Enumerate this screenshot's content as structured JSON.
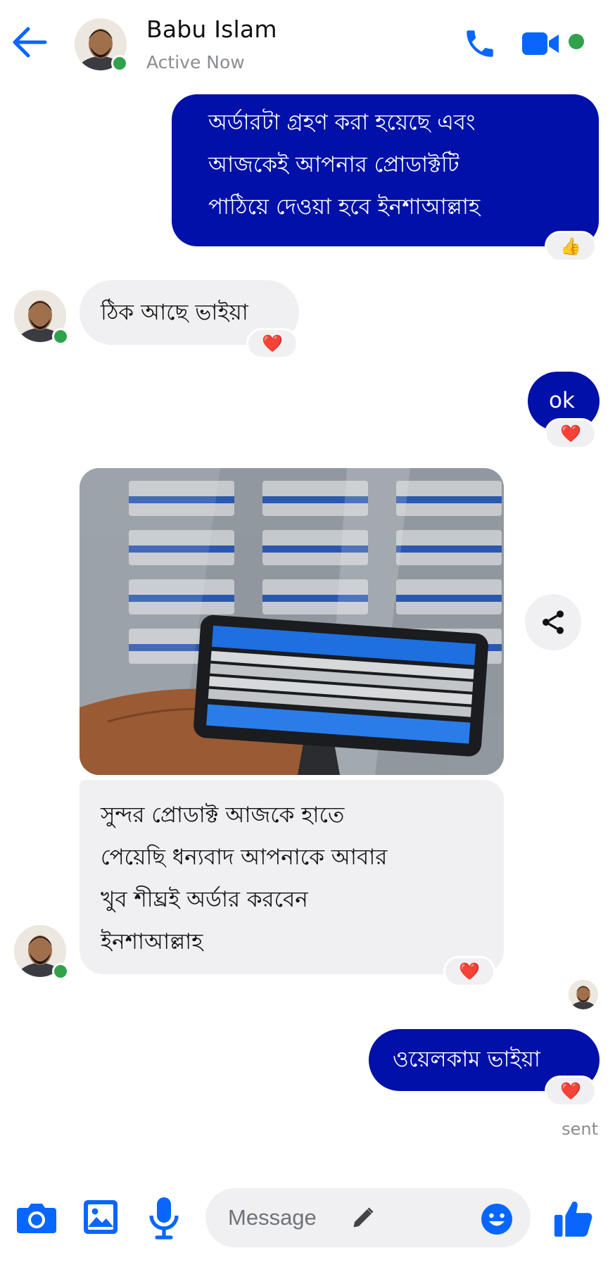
{
  "header": {
    "name": "Babu Islam",
    "status": "Active Now"
  },
  "messages": {
    "m1": {
      "direction": "outgoing",
      "text": "অর্ডারটা গ্রহণ করা হয়েছে এবং\nআজকেই আপনার প্রোডাক্টটি\nপাঠিয়ে দেওয়া হবে ইনশাআল্লাহ",
      "reaction": "👍"
    },
    "m2": {
      "direction": "incoming",
      "text": "ঠিক আছে ভাইয়া",
      "reaction": "❤️"
    },
    "m3": {
      "direction": "outgoing",
      "text": "ok",
      "reaction": "❤️"
    },
    "m4": {
      "direction": "incoming",
      "text": "সুন্দর প্রোডাক্ট আজকে হাতে\nপেয়েছি ধন্যবাদ আপনাকে আবার\nখুব শীঘ্রই অর্ডার করবেন\nইনশাআল্লাহ",
      "reaction": "❤️"
    },
    "m5": {
      "direction": "outgoing",
      "text": "ওয়েলকাম ভাইয়া",
      "reaction": "❤️",
      "receipt": "sent"
    }
  },
  "composer": {
    "placeholder": "Message"
  },
  "colors": {
    "accent": "#0866ff",
    "outgoing_bubble": "#0010a8",
    "incoming_bubble": "#f0f0f2",
    "online": "#31a24c",
    "reaction_heart": "#e41e3f"
  },
  "icons": [
    "back-arrow-icon",
    "phone-icon",
    "video-camera-icon",
    "share-icon",
    "camera-icon",
    "gallery-icon",
    "microphone-icon",
    "pencil-icon",
    "emoji-icon",
    "thumbs-up-icon"
  ]
}
